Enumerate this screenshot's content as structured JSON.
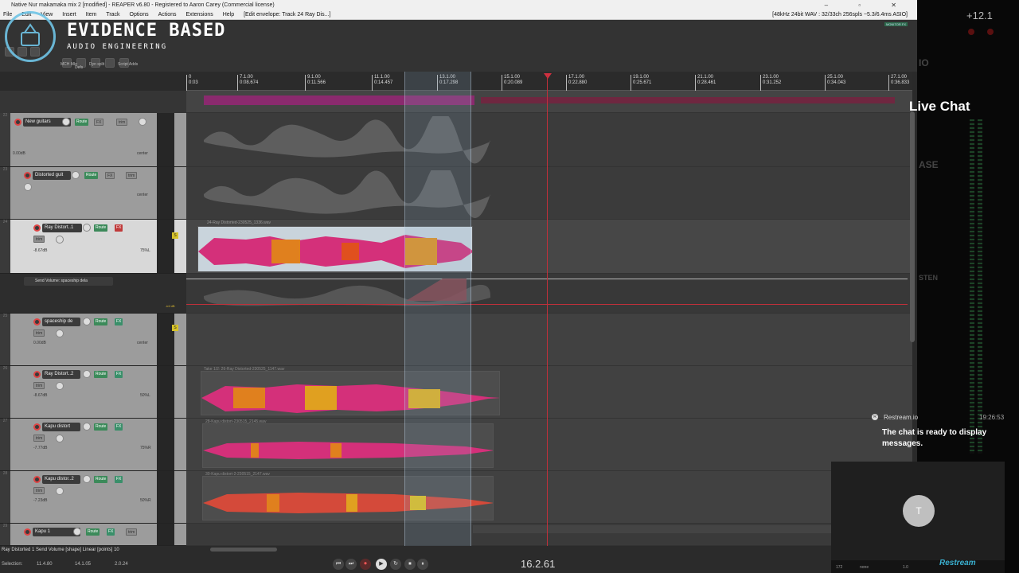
{
  "window": {
    "title": "Native Nur makamaka mix 2 [modified] - REAPER v6.80 - Registered to Aaron Carey (Commercial license)",
    "controls": "– ▫ ✕"
  },
  "menu": {
    "items": [
      "File",
      "Edit",
      "View",
      "Insert",
      "Item",
      "Track",
      "Options",
      "Actions",
      "Extensions",
      "Help"
    ],
    "envelope_context": "[Edit envelope: Track 24 Ray Dis...]",
    "audio_status": "[48kHz 24bit WAV : 32/33ch 256spls ~5.3/6.4ms ASIO]"
  },
  "toolbar": {
    "labels": [
      "MCH Mkr",
      "Defs",
      "Dyn split",
      "Script Adds"
    ],
    "monitor_fx": "MONITOR FX"
  },
  "logo": {
    "title": "EVIDENCE BASED",
    "subtitle": "AUDIO ENGINEERING",
    "color": "#6fc4e6"
  },
  "ruler": {
    "markers": [
      {
        "bar": "0",
        "time": "0:03"
      },
      {
        "bar": "7.1.00",
        "time": "0:08.674"
      },
      {
        "bar": "9.1.00",
        "time": "0:11.566"
      },
      {
        "bar": "11.1.00",
        "time": "0:14.457"
      },
      {
        "bar": "13.1.00",
        "time": "0:17.298"
      },
      {
        "bar": "15.1.00",
        "time": "0:20.089"
      },
      {
        "bar": "17.1.00",
        "time": "0:22.880"
      },
      {
        "bar": "19.1.00",
        "time": "0:25.671"
      },
      {
        "bar": "21.1.00",
        "time": "0:28.461"
      },
      {
        "bar": "23.1.00",
        "time": "0:31.252"
      },
      {
        "bar": "25.1.00",
        "time": "0:34.043"
      },
      {
        "bar": "27.1.00",
        "time": "0:36.833"
      }
    ]
  },
  "tracks": [
    {
      "num": "22",
      "name": "New guitars",
      "vol": "0.00dB",
      "pan": "center",
      "route": "Route",
      "fx": "FX",
      "trim": "trim"
    },
    {
      "num": "23",
      "name": "Distorted guit",
      "vol": "",
      "pan": "center",
      "route": "Route",
      "fx": "FX",
      "trim": "trim"
    },
    {
      "num": "24",
      "name": "Ray Distort..1",
      "vol": "-8.67dB",
      "pan": "75%L",
      "route": "Route",
      "fx": "FX",
      "trim": "trim"
    },
    {
      "num": "25",
      "name": "spaceship de",
      "vol": "0.00dB",
      "pan": "center",
      "route": "Route",
      "fx": "FX",
      "trim": "trim"
    },
    {
      "num": "26",
      "name": "Ray Distort..2",
      "vol": "-8.67dB",
      "pan": "50%L",
      "route": "Route",
      "fx": "FX",
      "trim": "trim"
    },
    {
      "num": "27",
      "name": "Kapu distort",
      "vol": "-7.77dB",
      "pan": "75%R",
      "route": "Route",
      "fx": "FX",
      "trim": "trim"
    },
    {
      "num": "28",
      "name": "Kapu distor..2",
      "vol": "-7.23dB",
      "pan": "50%R",
      "route": "Route",
      "fx": "FX",
      "trim": "trim"
    },
    {
      "num": "29",
      "name": "Kapu 1",
      "vol": "",
      "pan": "",
      "route": "Route",
      "fx": "FX",
      "trim": "trim"
    }
  ],
  "envelope_lane": {
    "name": "Send Volume: spaceship dela",
    "value": "-inf dB"
  },
  "items": {
    "ray1": "24-Ray Distorted-230525_1336.wav",
    "ray2": "Take 1/2: 26-Ray Distorted-230525_1147.wav",
    "kapu1": "28-Kapu distort-230515_2145.wav",
    "kapu2": "30-Kapu distort-2-230515_2147.wav"
  },
  "status": {
    "envelope_info": "Ray Distorted 1 Send Volume [shape] Linear [points] 10",
    "selection_label": "Selection:",
    "selection_start": "11.4.80",
    "selection_end": "14.1.05",
    "selection_length": "2.0.24",
    "time_readout": "16.2.61"
  },
  "transport": {
    "buttons": [
      "⏮",
      "⏭",
      "⏺",
      "▶",
      "↻",
      "⏹",
      "⏸"
    ]
  },
  "overlay": {
    "live_chat": "Live Chat",
    "meter_value": "+12.1",
    "ghost_labels": [
      "IO",
      "ASE",
      "STEN"
    ],
    "chat_source": "Restream.io",
    "chat_time": "19:26:53",
    "chat_message": "The chat is ready to display messages.",
    "avatar_initial": "T",
    "mini_labels": [
      "172",
      "none",
      "1.0"
    ],
    "brand_tag": "Restream"
  }
}
